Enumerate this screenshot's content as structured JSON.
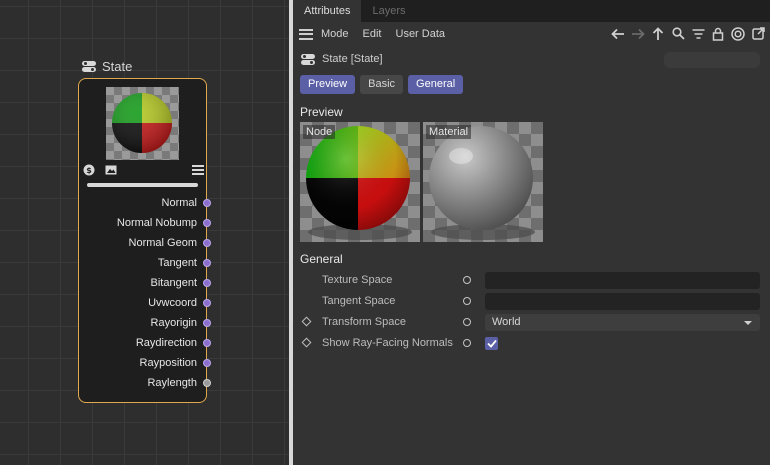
{
  "node_editor": {
    "node": {
      "title": "State",
      "ports": [
        {
          "label": "Normal"
        },
        {
          "label": "Normal Nobump"
        },
        {
          "label": "Normal Geom"
        },
        {
          "label": "Tangent"
        },
        {
          "label": "Bitangent"
        },
        {
          "label": "Uvwcoord"
        },
        {
          "label": "Rayorigin"
        },
        {
          "label": "Raydirection"
        },
        {
          "label": "Rayposition"
        },
        {
          "label": "Raylength"
        }
      ]
    },
    "colors": {
      "node_border": "#e0a94d",
      "port_purple": "#8a6fcc",
      "port_grey": "#9a9a9a"
    }
  },
  "attributes": {
    "tabs": [
      {
        "label": "Attributes",
        "active": true
      },
      {
        "label": "Layers",
        "active": false
      }
    ],
    "menu": [
      "Mode",
      "Edit",
      "User Data"
    ],
    "toolbar_icons": [
      "arrow-left-icon",
      "arrow-right-icon",
      "arrow-up-icon",
      "search-icon",
      "filter-icon",
      "lock-icon",
      "target-icon",
      "external-link-icon"
    ],
    "object_name": "State [State]",
    "modes": [
      {
        "label": "Preview",
        "active": true
      },
      {
        "label": "Basic",
        "active": false
      },
      {
        "label": "General",
        "active": true
      }
    ],
    "preview_section": {
      "title": "Preview",
      "labels": {
        "node": "Node",
        "material": "Material"
      }
    },
    "general_section": {
      "title": "General",
      "params": {
        "texture_space": {
          "label": "Texture Space"
        },
        "tangent_space": {
          "label": "Tangent Space"
        },
        "transform_space": {
          "label": "Transform Space",
          "value": "World"
        },
        "ray_facing": {
          "label": "Show Ray-Facing Normals",
          "checked": true
        }
      }
    },
    "colors": {
      "accent": "#5a5fa6"
    }
  }
}
